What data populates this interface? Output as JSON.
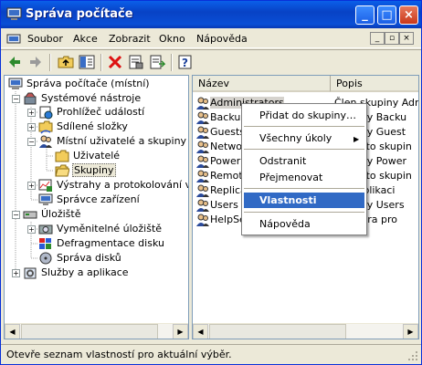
{
  "window": {
    "title": "Správa počítače"
  },
  "menu": [
    "Soubor",
    "Akce",
    "Zobrazit",
    "Okno",
    "Nápověda"
  ],
  "tree": [
    {
      "label": "Správa počítače (místní)",
      "icon": "computer-management-icon"
    },
    {
      "label": "Systémové nástroje",
      "icon": "system-tools-icon"
    },
    {
      "label": "Prohlížeč událostí",
      "icon": "event-viewer-icon"
    },
    {
      "label": "Sdílené složky",
      "icon": "shared-folders-icon"
    },
    {
      "label": "Místní uživatelé a skupiny",
      "icon": "local-users-icon"
    },
    {
      "label": "Uživatelé",
      "icon": "folder-icon"
    },
    {
      "label": "Skupiny",
      "icon": "folder-open-icon"
    },
    {
      "label": "Výstrahy a protokolování výk",
      "icon": "performance-logs-icon"
    },
    {
      "label": "Správce zařízení",
      "icon": "device-manager-icon"
    },
    {
      "label": "Úložiště",
      "icon": "storage-icon"
    },
    {
      "label": "Vyměnitelné úložiště",
      "icon": "removable-storage-icon"
    },
    {
      "label": "Defragmentace disku",
      "icon": "defrag-icon"
    },
    {
      "label": "Správa disků",
      "icon": "disk-management-icon"
    },
    {
      "label": "Služby a aplikace",
      "icon": "services-icon"
    }
  ],
  "columns": {
    "name": "Název",
    "desc": "Popis"
  },
  "groups": [
    {
      "name": "Administrators",
      "desc": "Člen skupiny Admin"
    },
    {
      "name": "Backup",
      "desc": "skupiny Backu"
    },
    {
      "name": "Guests",
      "desc": "skupiny Guest"
    },
    {
      "name": "Network",
      "desc": "ové této skupin"
    },
    {
      "name": "Power",
      "desc": "skupiny Power"
    },
    {
      "name": "Remote",
      "desc": "ové této skupin"
    },
    {
      "name": "Replicat",
      "desc": "uje replikaci"
    },
    {
      "name": "Users",
      "desc": "skupiny Users"
    },
    {
      "name": "HelpSe",
      "desc": "n Centra pro"
    }
  ],
  "context_menu": {
    "add_to_group": "Přidat do skupiny…",
    "all_tasks": "Všechny úkoly",
    "delete": "Odstranit",
    "rename": "Přejmenovat",
    "properties": "Vlastnosti",
    "help": "Nápověda"
  },
  "status": "Otevře seznam vlastností pro aktuální výběr."
}
